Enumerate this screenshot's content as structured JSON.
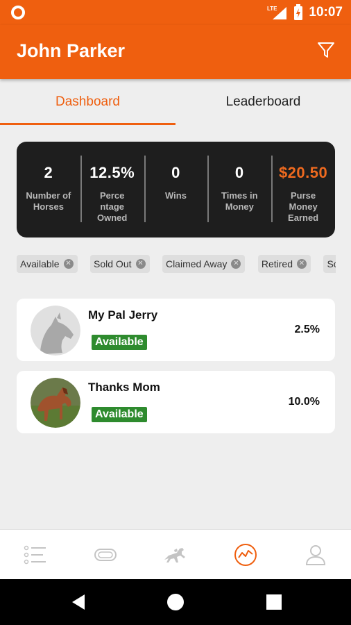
{
  "status_bar": {
    "time": "10:07",
    "network_label": "LTE",
    "icons": [
      "notification-dot-icon",
      "lte-signal-icon",
      "battery-charging-icon"
    ]
  },
  "app_bar": {
    "title": "John Parker",
    "filter_icon": "filter-icon"
  },
  "tabs": [
    {
      "label": "Dashboard",
      "active": true
    },
    {
      "label": "Leaderboard",
      "active": false
    }
  ],
  "stats": [
    {
      "value": "2",
      "label_lines": [
        "Number of",
        "Horses"
      ]
    },
    {
      "value": "12.5%",
      "label_lines": [
        "Perce",
        "ntage",
        "Owned"
      ]
    },
    {
      "value": "0",
      "label_lines": [
        "Wins"
      ]
    },
    {
      "value": "0",
      "label_lines": [
        "Times in",
        "Money"
      ]
    },
    {
      "value": "$20.50",
      "label_lines": [
        "Purse",
        "Money",
        "Earned"
      ]
    }
  ],
  "filter_chips": [
    {
      "label": "Available"
    },
    {
      "label": "Sold Out"
    },
    {
      "label": "Claimed Away"
    },
    {
      "label": "Retired"
    },
    {
      "label": "Sold A"
    }
  ],
  "horses": [
    {
      "name": "My Pal Jerry",
      "status": "Available",
      "percent": "2.5%",
      "avatar": "horse-silhouette-placeholder"
    },
    {
      "name": "Thanks Mom",
      "status": "Available",
      "percent": "10.0%",
      "avatar": "horse-photo"
    }
  ],
  "bottom_nav": [
    {
      "icon": "list-icon",
      "active": false
    },
    {
      "icon": "ticket-icon",
      "active": false
    },
    {
      "icon": "racing-horse-icon",
      "active": false
    },
    {
      "icon": "stats-chart-icon",
      "active": true
    },
    {
      "icon": "profile-icon",
      "active": false
    }
  ],
  "system_nav": [
    "back-icon",
    "home-icon",
    "recents-icon"
  ],
  "colors": {
    "primary": "#ef5f0f",
    "stats_card_bg": "#1e1e1e",
    "badge_green": "#2e8b2e",
    "background": "#eeeeee"
  }
}
